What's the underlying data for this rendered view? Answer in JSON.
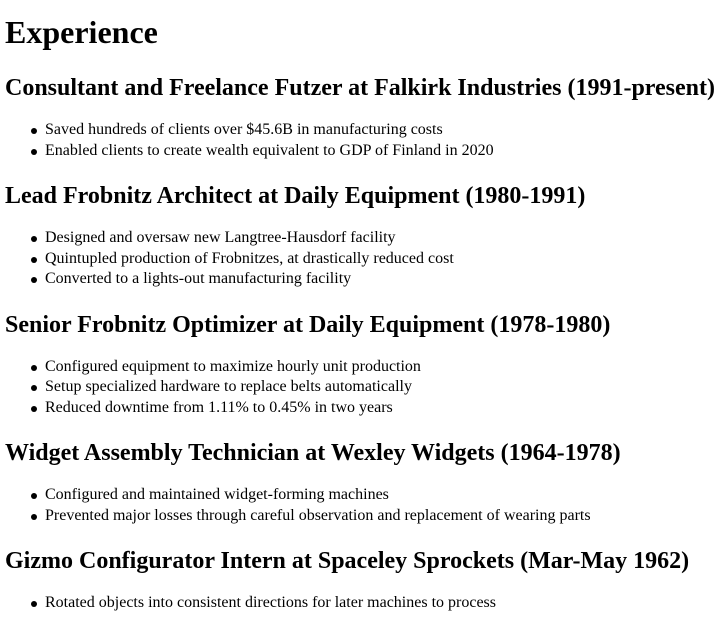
{
  "page": {
    "title": "Experience"
  },
  "jobs": [
    {
      "heading": "Consultant and Freelance Futzer at Falkirk Industries (1991-present)",
      "items": [
        "Saved hundreds of clients over $45.6B in manufacturing costs",
        "Enabled clients to create wealth equivalent to GDP of Finland in 2020"
      ]
    },
    {
      "heading": "Lead Frobnitz Architect at Daily Equipment (1980-1991)",
      "items": [
        "Designed and oversaw new Langtree-Hausdorf facility",
        "Quintupled production of Frobnitzes, at drastically reduced cost",
        "Converted to a lights-out manufacturing facility"
      ]
    },
    {
      "heading": "Senior Frobnitz Optimizer at Daily Equipment (1978-1980)",
      "items": [
        "Configured equipment to maximize hourly unit production",
        "Setup specialized hardware to replace belts automatically",
        "Reduced downtime from 1.11% to 0.45% in two years"
      ]
    },
    {
      "heading": "Widget Assembly Technician at Wexley Widgets (1964-1978)",
      "items": [
        "Configured and maintained widget-forming machines",
        "Prevented major losses through careful observation and replacement of wearing parts"
      ]
    },
    {
      "heading": "Gizmo Configurator Intern at Spaceley Sprockets (Mar-May 1962)",
      "items": [
        "Rotated objects into consistent directions for later machines to process"
      ]
    }
  ]
}
